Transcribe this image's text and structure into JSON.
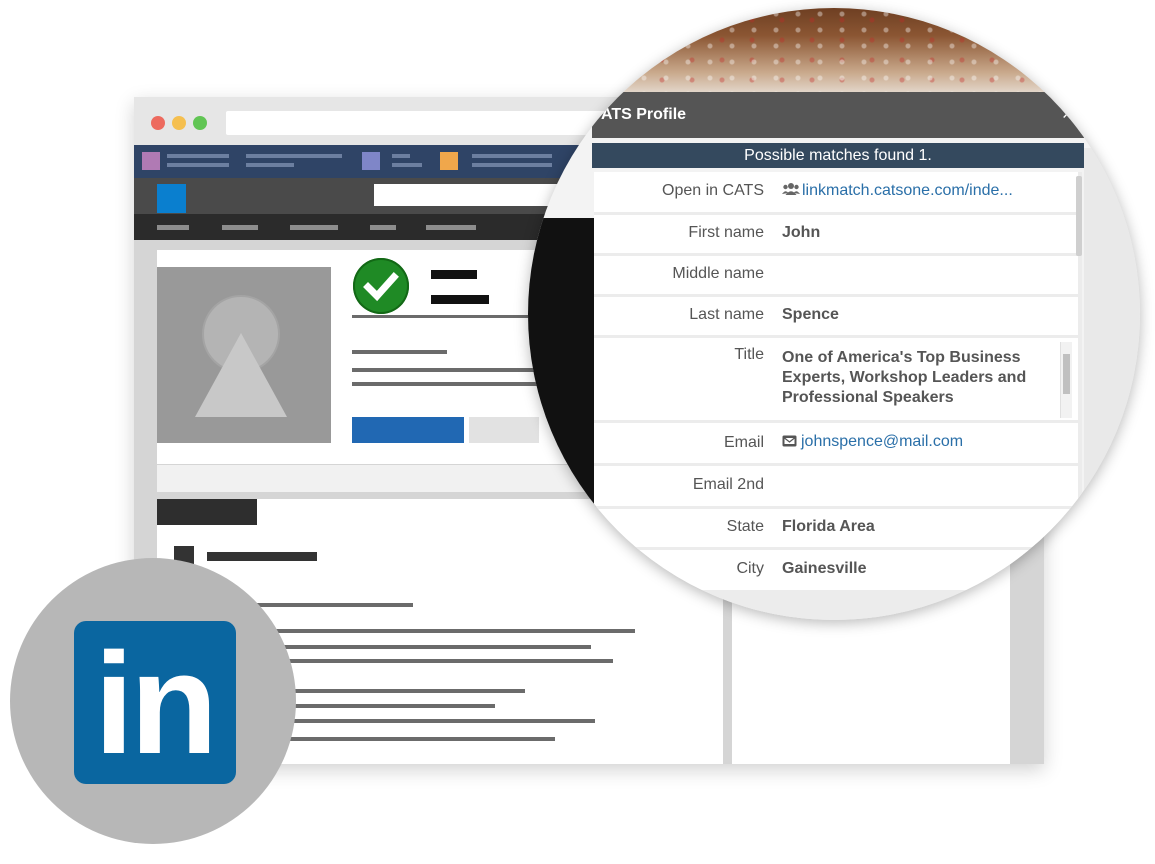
{
  "ats_panel": {
    "title": "ATS Profile",
    "close_icon": "close-icon",
    "matches_banner": "Possible matches found 1.",
    "fields": {
      "open_in_cats": {
        "label": "Open in CATS",
        "icon": "users-icon",
        "value": "linkmatch.catsone.com/inde..."
      },
      "first_name": {
        "label": "First name",
        "value": "John"
      },
      "middle_name": {
        "label": "Middle name",
        "value": ""
      },
      "last_name": {
        "label": "Last name",
        "value": "Spence"
      },
      "title": {
        "label": "Title",
        "value": "One of America's Top Business Experts, Workshop Leaders and Professional Speakers"
      },
      "email": {
        "label": "Email",
        "icon": "envelope-icon",
        "value": "johnspence@mail.com"
      },
      "email_2nd": {
        "label": "Email 2nd",
        "value": ""
      },
      "state": {
        "label": "State",
        "value": "Florida Area"
      },
      "city": {
        "label": "City",
        "value": "Gainesville"
      }
    }
  },
  "badge": {
    "text": "in",
    "icon": "linkedin-logo"
  },
  "colors": {
    "header_bg": "#555555",
    "banner_bg": "#34495e",
    "link": "#2a6fa8",
    "linkedin_blue": "#0a66a0",
    "verified_green": "#1f8a25"
  }
}
